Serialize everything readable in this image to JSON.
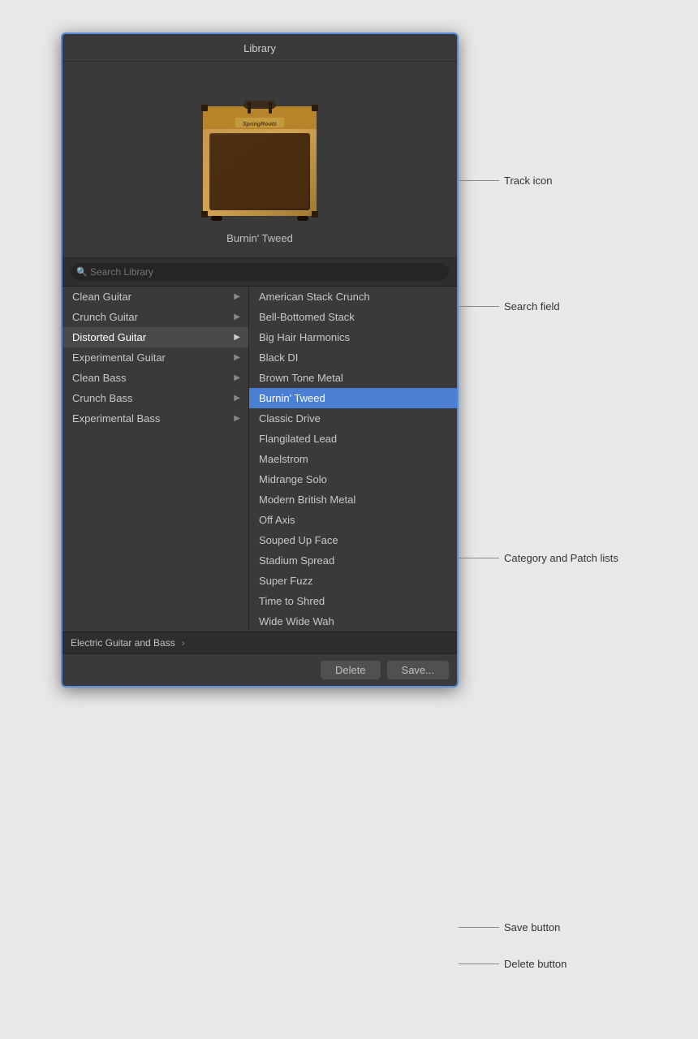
{
  "window": {
    "title": "Library"
  },
  "preview": {
    "preset_name": "Burnin' Tweed"
  },
  "search": {
    "placeholder": "Search Library"
  },
  "categories": [
    {
      "label": "Clean Guitar",
      "has_children": true,
      "active": false
    },
    {
      "label": "Crunch Guitar",
      "has_children": true,
      "active": false
    },
    {
      "label": "Distorted Guitar",
      "has_children": true,
      "active": true
    },
    {
      "label": "Experimental Guitar",
      "has_children": true,
      "active": false
    },
    {
      "label": "Clean Bass",
      "has_children": true,
      "active": false
    },
    {
      "label": "Crunch Bass",
      "has_children": true,
      "active": false
    },
    {
      "label": "Experimental Bass",
      "has_children": true,
      "active": false
    }
  ],
  "patches": [
    {
      "label": "American Stack Crunch",
      "selected": false
    },
    {
      "label": "Bell-Bottomed Stack",
      "selected": false
    },
    {
      "label": "Big Hair Harmonics",
      "selected": false
    },
    {
      "label": "Black DI",
      "selected": false
    },
    {
      "label": "Brown Tone Metal",
      "selected": false
    },
    {
      "label": "Burnin' Tweed",
      "selected": true
    },
    {
      "label": "Classic Drive",
      "selected": false
    },
    {
      "label": "Flangilated Lead",
      "selected": false
    },
    {
      "label": "Maelstrom",
      "selected": false
    },
    {
      "label": "Midrange Solo",
      "selected": false
    },
    {
      "label": "Modern British Metal",
      "selected": false
    },
    {
      "label": "Off Axis",
      "selected": false
    },
    {
      "label": "Souped Up Face",
      "selected": false
    },
    {
      "label": "Stadium Spread",
      "selected": false
    },
    {
      "label": "Super Fuzz",
      "selected": false
    },
    {
      "label": "Time to Shred",
      "selected": false
    },
    {
      "label": "Wide Wide Wah",
      "selected": false
    }
  ],
  "footer": {
    "path": "Electric Guitar and Bass",
    "arrow": "›"
  },
  "buttons": {
    "delete": "Delete",
    "save": "Save..."
  },
  "annotations": {
    "track_icon": "Track icon",
    "search_field": "Search field",
    "category_patch": "Category and Patch lists",
    "save_button": "Save button",
    "delete_button": "Delete button"
  }
}
